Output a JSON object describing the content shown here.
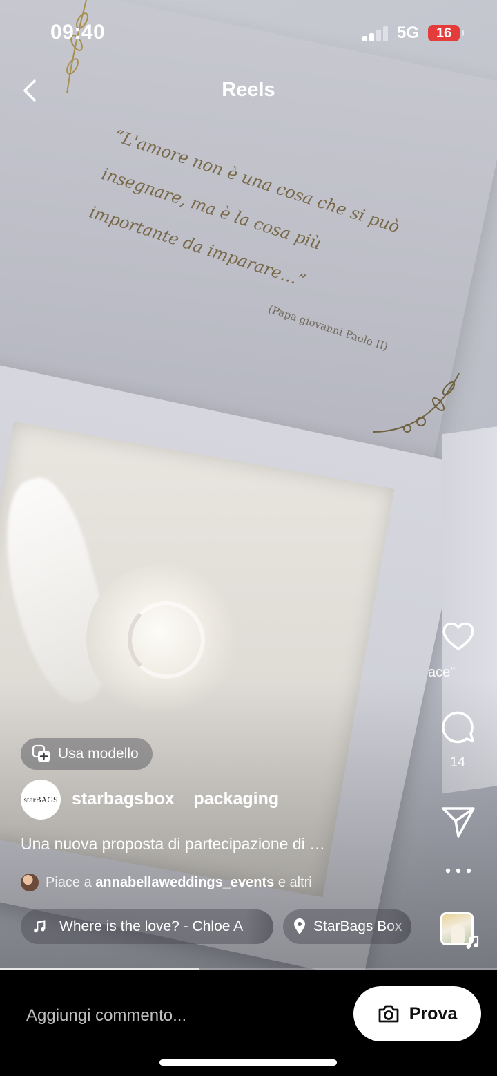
{
  "status_bar": {
    "time": "09:40",
    "network": "5G",
    "battery": "16"
  },
  "header": {
    "title": "Reels",
    "back_icon": "chevron-left-icon"
  },
  "video_frame": {
    "quote": "“L'amore non è una cosa che si può insegnare, ma è la cosa più importante da imparare…”",
    "quote_author": "(Papa giovanni Paolo II)"
  },
  "actions": {
    "like_icon": "heart-icon",
    "like_label": "ace\"",
    "comment_icon": "comment-bubble-icon",
    "comment_count": "14",
    "share_icon": "paper-plane-icon",
    "more_icon": "more-horizontal-icon",
    "audio_icon": "music-note-icon"
  },
  "template_chip": {
    "label": "Usa modello",
    "icon": "template-add-icon"
  },
  "post": {
    "avatar_text": "starBAGS",
    "username": "starbagsbox__packaging",
    "caption": "Una nuova proposta di partecipazione di …",
    "likes_prefix": "Piace a",
    "likes_user": "annabellaweddings_events",
    "likes_suffix": "e altri"
  },
  "audio": {
    "track": "Where is the love? - Chloe A",
    "icon": "music-note-icon"
  },
  "location": {
    "name": "StarBags Box",
    "icon": "location-pin-icon"
  },
  "progress": {
    "fraction": 0.4
  },
  "bottom_bar": {
    "comment_placeholder": "Aggiungi commento...",
    "prova_label": "Prova",
    "prova_icon": "camera-icon"
  },
  "colors": {
    "battery_low": "#e43b3b",
    "quote_gold": "#6c5a33"
  }
}
